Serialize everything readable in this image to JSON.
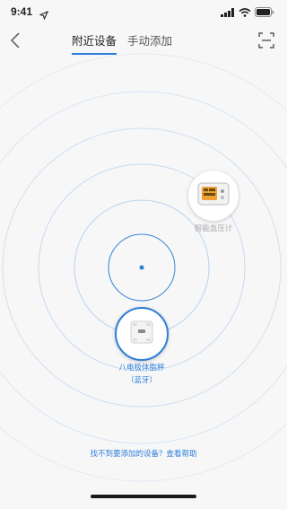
{
  "status_bar": {
    "time": "9:41",
    "icons": [
      "location-icon",
      "signal-icon",
      "wifi-icon",
      "battery-icon"
    ]
  },
  "nav": {
    "back_icon": "back-chevron-icon",
    "tabs": [
      {
        "label": "附近设备",
        "active": true
      },
      {
        "label": "手动添加",
        "active": false
      }
    ],
    "scan_icon": "scan-icon"
  },
  "devices": [
    {
      "label": "智能血压计",
      "icon": "blood-pressure-monitor-icon",
      "selected": false
    },
    {
      "label_line1": "八电极体脂秤",
      "label_line2": "（蓝牙）",
      "icon": "body-fat-scale-icon",
      "selected": true
    }
  ],
  "help_link": "找不到要添加的设备？查看帮助",
  "colors": {
    "accent": "#2f7fd9",
    "radar_ring": "#c9dcef",
    "background": "#f7f7f7"
  }
}
